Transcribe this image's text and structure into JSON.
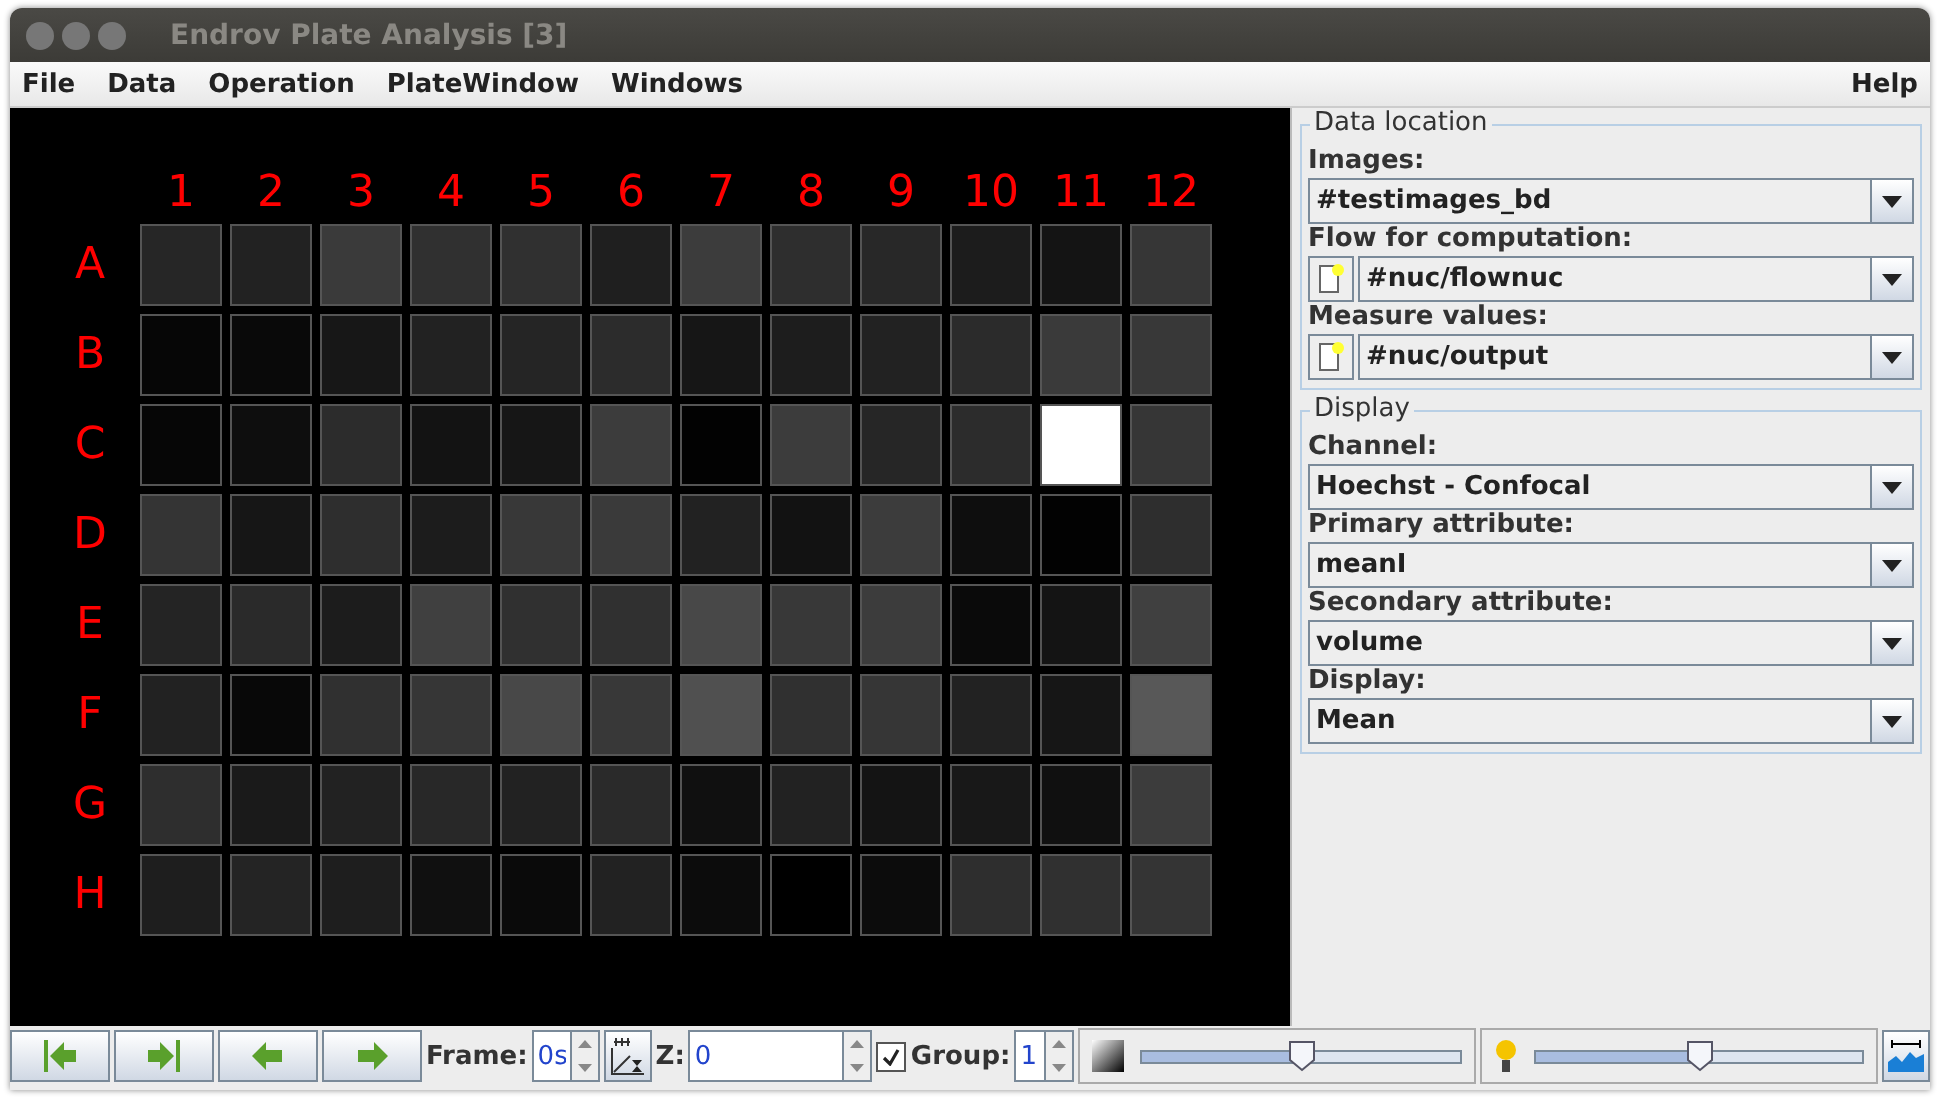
{
  "window": {
    "title": "Endrov Plate Analysis [3]"
  },
  "menu": [
    "File",
    "Data",
    "Operation",
    "PlateWindow",
    "Windows"
  ],
  "help_menu": "Help",
  "plate": {
    "columns": [
      "1",
      "2",
      "3",
      "4",
      "5",
      "6",
      "7",
      "8",
      "9",
      "10",
      "11",
      "12"
    ],
    "rows": [
      {
        "label": "A",
        "wells": [
          {
            "color": "#262626"
          },
          {
            "color": "#222222"
          },
          {
            "color": "#3a3a3a"
          },
          {
            "color": "#303030"
          },
          {
            "color": "#303030"
          },
          {
            "color": "#1f1f1f"
          },
          {
            "color": "#3c3c3c"
          },
          {
            "color": "#2e2e2e"
          },
          {
            "color": "#282828"
          },
          {
            "color": "#1c1c1c"
          },
          {
            "color": "#141414"
          },
          {
            "color": "#363636"
          }
        ]
      },
      {
        "label": "B",
        "wells": [
          {
            "color": "#060606"
          },
          {
            "color": "#090909"
          },
          {
            "color": "#171717"
          },
          {
            "color": "#222222"
          },
          {
            "color": "#252525"
          },
          {
            "color": "#2c2c2c"
          },
          {
            "color": "#161616"
          },
          {
            "color": "#1d1d1d"
          },
          {
            "color": "#222222"
          },
          {
            "color": "#2b2b2b"
          },
          {
            "color": "#3a3a3a"
          },
          {
            "color": "#383838"
          }
        ]
      },
      {
        "label": "C",
        "wells": [
          {
            "color": "#060606"
          },
          {
            "color": "#0e0e0e"
          },
          {
            "color": "#2c2c2c"
          },
          {
            "color": "#131313"
          },
          {
            "color": "#161616"
          },
          {
            "color": "#3c3c3c"
          },
          {
            "color": "#020202"
          },
          {
            "color": "#3c3c3c"
          },
          {
            "color": "#262626"
          },
          {
            "color": "#2c2c2c"
          },
          {
            "color": "#ffffff"
          },
          {
            "color": "#363636"
          }
        ]
      },
      {
        "label": "D",
        "wells": [
          {
            "color": "#343434"
          },
          {
            "color": "#161616"
          },
          {
            "color": "#2e2e2e"
          },
          {
            "color": "#1c1c1c"
          },
          {
            "color": "#383838"
          },
          {
            "color": "#3a3a3a"
          },
          {
            "color": "#222222"
          },
          {
            "color": "#121212"
          },
          {
            "color": "#3c3c3c"
          },
          {
            "color": "#0e0e0e"
          },
          {
            "color": "#020202"
          },
          {
            "color": "#2e2e2e"
          }
        ]
      },
      {
        "label": "E",
        "wells": [
          {
            "color": "#242424"
          },
          {
            "color": "#2a2a2a"
          },
          {
            "color": "#1c1c1c"
          },
          {
            "color": "#404040"
          },
          {
            "color": "#303030"
          },
          {
            "color": "#303030"
          },
          {
            "color": "#484848"
          },
          {
            "color": "#383838"
          },
          {
            "color": "#3c3c3c"
          },
          {
            "color": "#0a0a0a"
          },
          {
            "color": "#141414"
          },
          {
            "color": "#404040"
          }
        ]
      },
      {
        "label": "F",
        "wells": [
          {
            "color": "#222222"
          },
          {
            "color": "#080808"
          },
          {
            "color": "#303030"
          },
          {
            "color": "#363636"
          },
          {
            "color": "#484848"
          },
          {
            "color": "#383838"
          },
          {
            "color": "#505050"
          },
          {
            "color": "#303030"
          },
          {
            "color": "#363636"
          },
          {
            "color": "#222222"
          },
          {
            "color": "#161616"
          },
          {
            "color": "#585858"
          }
        ]
      },
      {
        "label": "G",
        "wells": [
          {
            "color": "#2e2e2e"
          },
          {
            "color": "#1a1a1a"
          },
          {
            "color": "#222222"
          },
          {
            "color": "#282828"
          },
          {
            "color": "#222222"
          },
          {
            "color": "#2a2a2a"
          },
          {
            "color": "#101010"
          },
          {
            "color": "#222222"
          },
          {
            "color": "#141414"
          },
          {
            "color": "#181818"
          },
          {
            "color": "#101010"
          },
          {
            "color": "#3c3c3c"
          }
        ]
      },
      {
        "label": "H",
        "wells": [
          {
            "color": "#1e1e1e"
          },
          {
            "color": "#242424"
          },
          {
            "color": "#1e1e1e"
          },
          {
            "color": "#101010"
          },
          {
            "color": "#0a0a0a"
          },
          {
            "color": "#222222"
          },
          {
            "color": "#0c0c0c"
          },
          {
            "color": "#000000"
          },
          {
            "color": "#0c0c0c"
          },
          {
            "color": "#2e2e2e"
          },
          {
            "color": "#303030"
          },
          {
            "color": "#343434"
          }
        ]
      }
    ]
  },
  "panels": [
    {
      "title": "Data location",
      "fields": [
        {
          "label": "Images:",
          "value": "#testimages_bd",
          "kind": "plain"
        },
        {
          "label": "Flow for computation:",
          "value": "#nuc/flownuc",
          "kind": "file"
        },
        {
          "label": "Measure values:",
          "value": "#nuc/output",
          "kind": "file"
        }
      ]
    },
    {
      "title": "Display",
      "fields": [
        {
          "label": "Channel:",
          "value": "Hoechst - Confocal",
          "kind": "plain"
        },
        {
          "label": "Primary attribute:",
          "value": "meanI",
          "kind": "plain"
        },
        {
          "label": "Secondary attribute:",
          "value": "volume",
          "kind": "plain"
        },
        {
          "label": "Display:",
          "value": "Mean",
          "kind": "plain"
        }
      ]
    }
  ],
  "toolbar": {
    "frame_label": "Frame:",
    "frame_value": "0s",
    "z_label": "Z:",
    "z_value": "0",
    "group_checked": true,
    "group_label": "Group:",
    "group_value": "1",
    "contrast": {
      "level": 0.5
    },
    "brightness": {
      "level": 0.5
    }
  }
}
